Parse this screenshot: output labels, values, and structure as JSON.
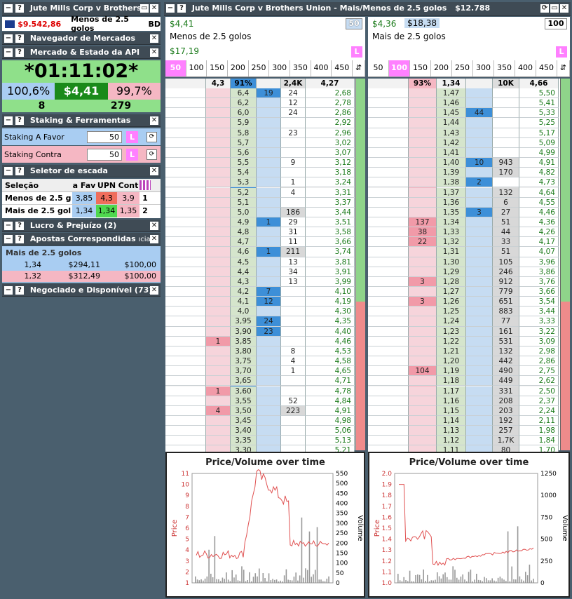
{
  "left": {
    "title": "Jute Mills Corp v Brothers",
    "balance": "$9.542,86",
    "selection": "Menos de 2.5 golos",
    "sel_suffix": "BD",
    "nav": "Navegador de Mercados",
    "state": "Mercado & Estado da API",
    "timer": "*01:11:02*",
    "back_pct": "100,6%",
    "matched": "$4,41",
    "lay_pct": "99,7%",
    "count_left": "8",
    "count_right": "279",
    "staking": "Staking & Ferramentas",
    "stake_for_label": "Staking A Favor",
    "stake_for": "50",
    "stake_against_label": "Staking Contra",
    "stake_against": "50",
    "stake_l": "L",
    "ladder_sel": "Seletor de escada",
    "ladder_head": [
      "Seleção",
      "a Fav",
      "UPN",
      "Cont"
    ],
    "ladder_rows": [
      {
        "name": "Menos de 2.5 g",
        "fav": "3,85",
        "upn": "4,3",
        "cont": "3,9",
        "n": "1"
      },
      {
        "name": "Mais de 2.5 gol",
        "fav": "1,34",
        "upn": "1,34",
        "cont": "1,35",
        "n": "2"
      }
    ],
    "pnl": "Lucro & Prejuízo (2)",
    "matched_bets": "Apostas Correspondidas",
    "matched_suffix": "ıcia",
    "bet_group": "Mais de 2.5 golos",
    "bets": [
      {
        "odds": "1,34",
        "ret": "$294,11",
        "stake": "$100,00"
      },
      {
        "odds": "1,32",
        "ret": "$312,49",
        "stake": "$100,00"
      }
    ],
    "traded": "Negociado e Disponível (73)"
  },
  "main": {
    "title": "Jute Mills Corp v Brothers Union - Mais/Menos de 2.5 golos",
    "amount": "$12.788",
    "l": {
      "pl": "$4,41",
      "name": "Menos de 2.5 golos",
      "profit": "$17,19",
      "stake": "50",
      "stakes": [
        "50",
        "100",
        "150",
        "200",
        "250",
        "300",
        "350",
        "400",
        "450"
      ],
      "hdr": {
        "lay": "4,3",
        "pct": "91%",
        "vol": "2,4K",
        "ltp": "4,27"
      },
      "rows": [
        [
          "",
          "6,4",
          "19",
          "24",
          "2,68"
        ],
        [
          "",
          "6,2",
          "",
          "12",
          "2,78"
        ],
        [
          "",
          "6,0",
          "",
          "24",
          "2,86"
        ],
        [
          "",
          "5,9",
          "",
          "",
          "2,92"
        ],
        [
          "",
          "5,8",
          "",
          "23",
          "2,96"
        ],
        [
          "",
          "5,7",
          "",
          "",
          "3,02"
        ],
        [
          "",
          "5,6",
          "",
          "",
          "3,07"
        ],
        [
          "",
          "5,5",
          "",
          "9",
          "3,12"
        ],
        [
          "",
          "5,4",
          "",
          "",
          "3,18"
        ],
        [
          "",
          "5,3",
          "",
          "1",
          "3,24"
        ],
        [
          "",
          "5,2",
          "",
          "4",
          "3,31"
        ],
        [
          "",
          "5,1",
          "",
          "",
          "3,37"
        ],
        [
          "",
          "5,0",
          "",
          "186",
          "3,44"
        ],
        [
          "",
          "4,9",
          "1",
          "29",
          "3,51"
        ],
        [
          "",
          "4,8",
          "",
          "31",
          "3,58"
        ],
        [
          "",
          "4,7",
          "",
          "11",
          "3,66"
        ],
        [
          "",
          "4,6",
          "1",
          "211",
          "3,74"
        ],
        [
          "",
          "4,5",
          "",
          "13",
          "3,81"
        ],
        [
          "",
          "4,4",
          "",
          "34",
          "3,91"
        ],
        [
          "",
          "4,3",
          "",
          "13",
          "3,99"
        ],
        [
          "",
          "4,2",
          "7",
          "",
          "4,10"
        ],
        [
          "",
          "4,1",
          "12",
          "",
          "4,19"
        ],
        [
          "",
          "4,0",
          "",
          "",
          "4,30"
        ],
        [
          "",
          "3,95",
          "24",
          "",
          "4,35"
        ],
        [
          "",
          "3,90",
          "23",
          "",
          "4,40"
        ],
        [
          "1",
          "3,85",
          "",
          "",
          "4,46"
        ],
        [
          "",
          "3,80",
          "",
          "8",
          "4,53"
        ],
        [
          "",
          "3,75",
          "",
          "4",
          "4,58"
        ],
        [
          "",
          "3,70",
          "",
          "1",
          "4,65"
        ],
        [
          "",
          "3,65",
          "",
          "",
          "4,71"
        ],
        [
          "1",
          "3,60",
          "",
          "",
          "4,78"
        ],
        [
          "",
          "3,55",
          "",
          "52",
          "4,84"
        ],
        [
          "4",
          "3,50",
          "",
          "223",
          "4,91"
        ],
        [
          "",
          "3,45",
          "",
          "",
          "4,98"
        ],
        [
          "",
          "3,40",
          "",
          "",
          "5,06"
        ],
        [
          "",
          "3,35",
          "",
          "",
          "5,13"
        ],
        [
          "",
          "3,30",
          "",
          "",
          "5,21"
        ]
      ]
    },
    "r": {
      "pl": "$4,36",
      "balance": "$18,38",
      "name": "Mais de 2.5 golos",
      "stake": "100",
      "stakes": [
        "50",
        "100",
        "150",
        "200",
        "250",
        "300",
        "350",
        "400",
        "450"
      ],
      "hdr": {
        "lay": "93%",
        "price": "1,34",
        "vol": "10K",
        "ltp": "4,66"
      },
      "rows": [
        [
          "",
          "1,47",
          "",
          "",
          "5,50"
        ],
        [
          "",
          "1,46",
          "",
          "",
          "5,41"
        ],
        [
          "",
          "1,45",
          "44",
          "",
          "5,33"
        ],
        [
          "",
          "1,44",
          "",
          "",
          "5,25"
        ],
        [
          "",
          "1,43",
          "",
          "",
          "5,17"
        ],
        [
          "",
          "1,42",
          "",
          "",
          "5,09"
        ],
        [
          "",
          "1,41",
          "",
          "",
          "4,99"
        ],
        [
          "",
          "1,40",
          "10",
          "943",
          "4,91"
        ],
        [
          "",
          "1,39",
          "",
          "170",
          "4,82"
        ],
        [
          "",
          "1,38",
          "2",
          "",
          "4,73"
        ],
        [
          "",
          "1,37",
          "",
          "132",
          "4,64"
        ],
        [
          "",
          "1,36",
          "",
          "6",
          "4,55"
        ],
        [
          "",
          "1,35",
          "3",
          "27",
          "4,46"
        ],
        [
          "137",
          "1,34",
          "",
          "51",
          "4,36"
        ],
        [
          "38",
          "1,33",
          "",
          "44",
          "4,26"
        ],
        [
          "22",
          "1,32",
          "",
          "33",
          "4,17"
        ],
        [
          "",
          "1,31",
          "",
          "51",
          "4,07"
        ],
        [
          "",
          "1,30",
          "",
          "105",
          "3,96"
        ],
        [
          "",
          "1,29",
          "",
          "246",
          "3,86"
        ],
        [
          "3",
          "1,28",
          "",
          "912",
          "3,76"
        ],
        [
          "",
          "1,27",
          "",
          "779",
          "3,66"
        ],
        [
          "3",
          "1,26",
          "",
          "651",
          "3,54"
        ],
        [
          "",
          "1,25",
          "",
          "883",
          "3,44"
        ],
        [
          "",
          "1,24",
          "",
          "77",
          "3,33"
        ],
        [
          "",
          "1,23",
          "",
          "161",
          "3,22"
        ],
        [
          "",
          "1,22",
          "",
          "531",
          "3,09"
        ],
        [
          "",
          "1,21",
          "",
          "132",
          "2,98"
        ],
        [
          "",
          "1,20",
          "",
          "442",
          "2,86"
        ],
        [
          "104",
          "1,19",
          "",
          "490",
          "2,75"
        ],
        [
          "",
          "1,18",
          "",
          "449",
          "2,62"
        ],
        [
          "",
          "1,17",
          "",
          "331",
          "2,50"
        ],
        [
          "",
          "1,16",
          "",
          "208",
          "2,37"
        ],
        [
          "",
          "1,15",
          "",
          "203",
          "2,24"
        ],
        [
          "",
          "1,14",
          "",
          "192",
          "2,11"
        ],
        [
          "",
          "1,13",
          "",
          "257",
          "1,98"
        ],
        [
          "",
          "1,12",
          "",
          "1,7K",
          "1,84"
        ],
        [
          "",
          "1,11",
          "",
          "80",
          "1,70"
        ]
      ]
    }
  },
  "charts": {
    "title": "Price/Volume over time",
    "ylabel": "Price",
    "y2label": "Volume",
    "left_ticks": [
      "1",
      "2",
      "3",
      "4",
      "5",
      "6",
      "7",
      "8",
      "9",
      "10",
      "11"
    ],
    "left_vticks": [
      "0",
      "50",
      "100",
      "150",
      "200",
      "250",
      "300",
      "350",
      "400",
      "450",
      "500",
      "550"
    ],
    "right_ticks": [
      "1.0",
      "1.1",
      "1.2",
      "1.3",
      "1.4",
      "1.5",
      "1.6",
      "1.7",
      "1.8",
      "1.9",
      "2.0"
    ],
    "right_vticks": [
      "0",
      "250",
      "500",
      "750",
      "1000",
      "1250"
    ]
  },
  "colors": {
    "accent": "#ff80ff",
    "back": "#c6dcf2",
    "lay": "#f6d4db",
    "price": "#d5e5cc",
    "line": "#e05050"
  }
}
